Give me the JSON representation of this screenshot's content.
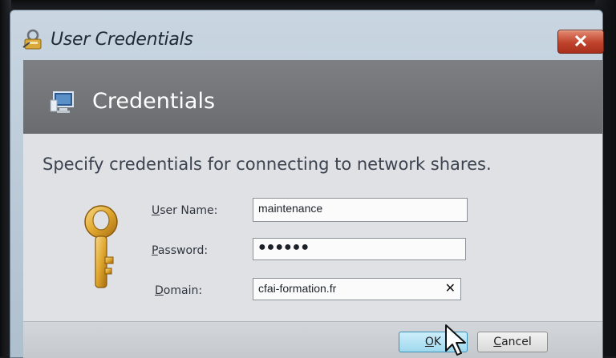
{
  "window": {
    "title": "User Credentials",
    "close_glyph": "✕"
  },
  "banner": {
    "title": "Credentials"
  },
  "instruction": "Specify credentials for connecting to network shares.",
  "form": {
    "user_name_label_key": "U",
    "user_name_label_rest": "ser Name:",
    "user_name_value": "maintenance",
    "password_label_key": "P",
    "password_label_rest": "assword:",
    "password_value": "●●●●●●",
    "domain_label_key": "D",
    "domain_label_rest": "omain:",
    "domain_value": "cfai-formation.fr",
    "clear_glyph": "✕"
  },
  "buttons": {
    "ok_key": "O",
    "ok_rest": "K",
    "cancel_key": "C",
    "cancel_rest": "ancel"
  },
  "icons": {
    "app": "key-ring-icon",
    "banner": "computer-monitor-icon",
    "key": "key-icon",
    "cursor": "mouse-pointer-icon"
  },
  "colors": {
    "banner_bg": "#6f7174",
    "close_btn": "#c0432c",
    "ok_btn": "#9fd8ee"
  }
}
